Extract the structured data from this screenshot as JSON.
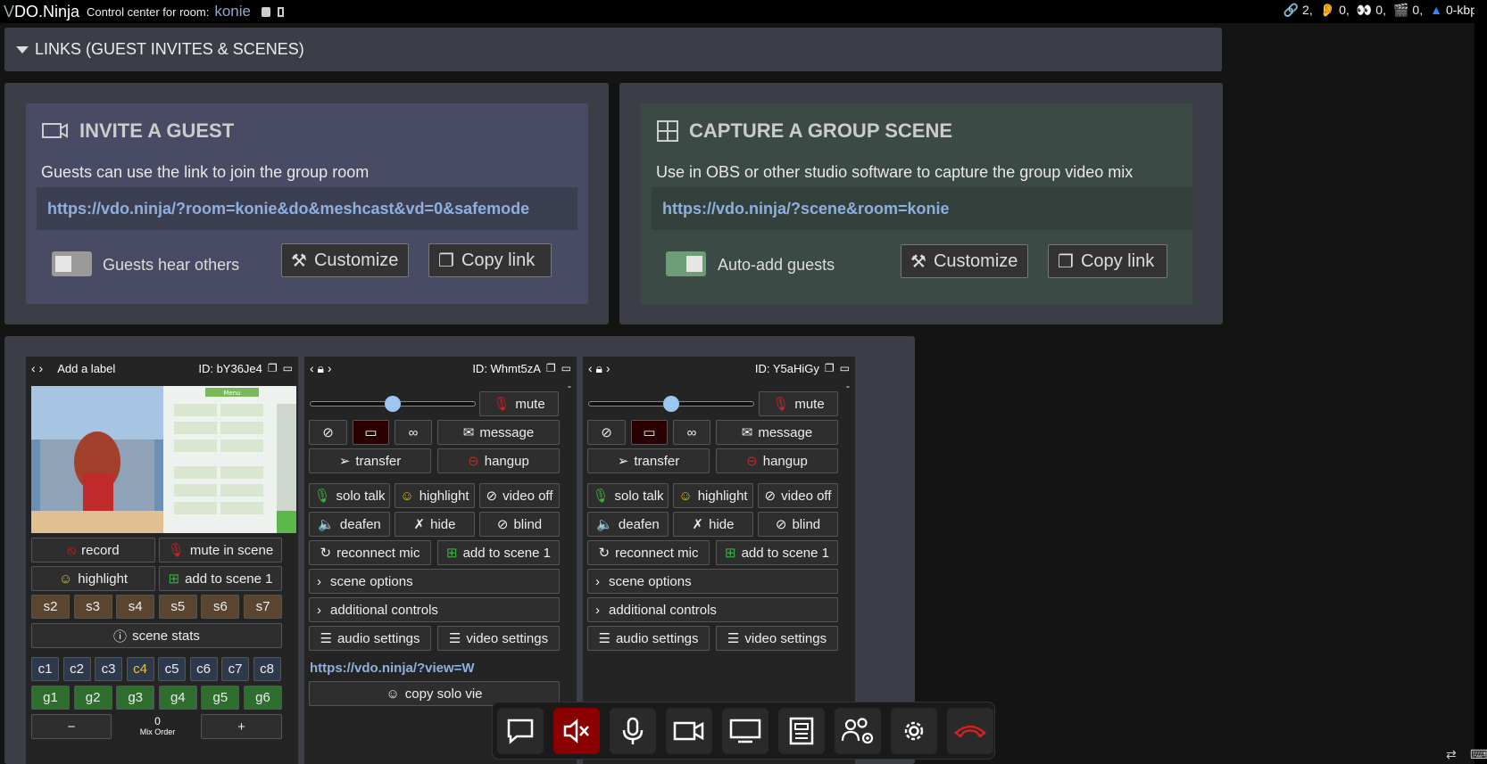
{
  "topbar": {
    "brand_v": "V",
    "brand_rest": "DO.Ninja",
    "control_text": "Control center for room:",
    "room": "konie",
    "stats": {
      "links": "2,",
      "ears": "0,",
      "eyes": "0,",
      "scenes": "0,",
      "bitrate": "0-kbps"
    }
  },
  "links": {
    "title": "LINKS (GUEST INVITES & SCENES)"
  },
  "invite": {
    "title": "INVITE A GUEST",
    "desc": "Guests can use the link to join the group room",
    "url": "https://vdo.ninja/?room=konie&do&meshcast&vd=0&safemode",
    "toggle_label": "Guests hear others",
    "customize": "Customize",
    "copy": "Copy link"
  },
  "scene": {
    "title": "CAPTURE A GROUP SCENE",
    "desc": "Use in OBS or other studio software to capture the group video mix",
    "url": "https://vdo.ninja/?scene&room=konie",
    "toggle_label": "Auto-add guests",
    "customize": "Customize",
    "copy": "Copy link"
  },
  "guest1": {
    "label": "Add a label",
    "id": "ID: bY36Je4",
    "record": "record",
    "mute_scene": "mute in scene",
    "highlight": "highlight",
    "add_scene": "add to scene 1",
    "scenes": [
      "s2",
      "s3",
      "s4",
      "s5",
      "s6",
      "s7"
    ],
    "scene_stats": "scene stats",
    "channels": [
      "c1",
      "c2",
      "c3",
      "c4",
      "c5",
      "c6",
      "c7",
      "c8"
    ],
    "groups": [
      "g1",
      "g2",
      "g3",
      "g4",
      "g5",
      "g6"
    ],
    "minus": "−",
    "plus": "+",
    "mix_value": "0",
    "mix_label": "Mix Order",
    "preview_menu": "Menu"
  },
  "guest2": {
    "id": "ID: Whmt5zA",
    "dash": "-",
    "volume": 0.5,
    "mute": "mute",
    "message": "message",
    "transfer": "transfer",
    "hangup": "hangup",
    "solo": "solo talk",
    "highlight": "highlight",
    "video_off": "video off",
    "deafen": "deafen",
    "hide": "hide",
    "blind": "blind",
    "reconnect": "reconnect mic",
    "add_scene": "add to scene 1",
    "scene_opts": "scene options",
    "additional": "additional controls",
    "audio": "audio settings",
    "video": "video settings",
    "url": "https://vdo.ninja/?view=W",
    "copy_solo": "copy solo vie"
  },
  "guest3": {
    "id": "ID: Y5aHiGy",
    "dash": "-",
    "volume": 0.5,
    "mute": "mute",
    "message": "message",
    "transfer": "transfer",
    "hangup": "hangup",
    "solo": "solo talk",
    "highlight": "highlight",
    "video_off": "video off",
    "deafen": "deafen",
    "hide": "hide",
    "blind": "blind",
    "reconnect": "reconnect mic",
    "add_scene": "add to scene 1",
    "scene_opts": "scene options",
    "additional": "additional controls",
    "audio": "audio settings",
    "video": "video settings"
  },
  "colors": {
    "accent_link": "#8fb0dc",
    "toggle_on": "#6e9c76",
    "hangup_red": "#d42020",
    "dock_red": "#8b0000"
  }
}
